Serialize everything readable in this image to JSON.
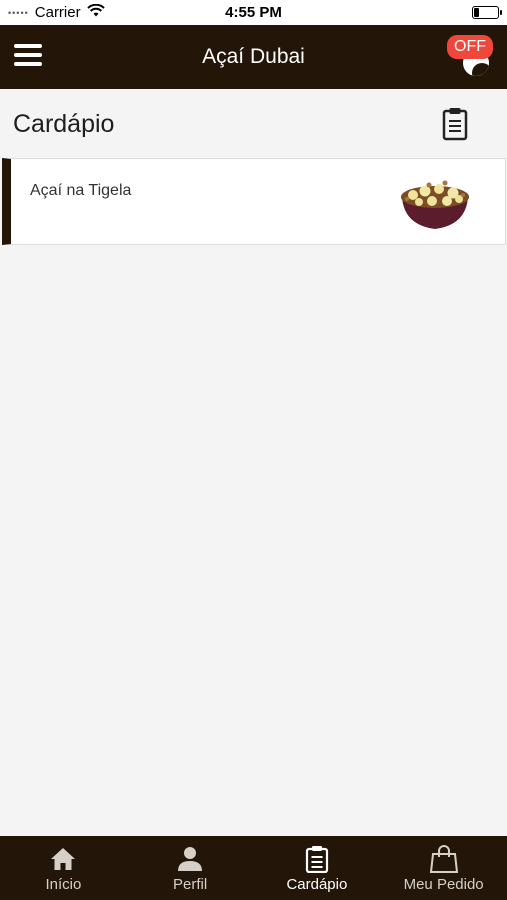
{
  "status_bar": {
    "signal": "•••••",
    "carrier": "Carrier",
    "time": "4:55 PM",
    "battery_level": 0.2
  },
  "header": {
    "title": "Açaí Dubai",
    "status_badge": "OFF"
  },
  "section": {
    "title": "Cardápio"
  },
  "menu_items": [
    {
      "label": "Açaí na Tigela",
      "image": "acai-bowl"
    }
  ],
  "tabs": [
    {
      "label": "Início",
      "icon": "home-icon",
      "active": false
    },
    {
      "label": "Perfil",
      "icon": "person-icon",
      "active": false
    },
    {
      "label": "Cardápio",
      "icon": "clipboard-icon",
      "active": true
    },
    {
      "label": "Meu Pedido",
      "icon": "shopping-bag-icon",
      "active": false
    }
  ],
  "colors": {
    "header_bg": "#241509",
    "accent": "#241509",
    "badge_off": "#f0473c",
    "background": "#f4f4f4"
  }
}
